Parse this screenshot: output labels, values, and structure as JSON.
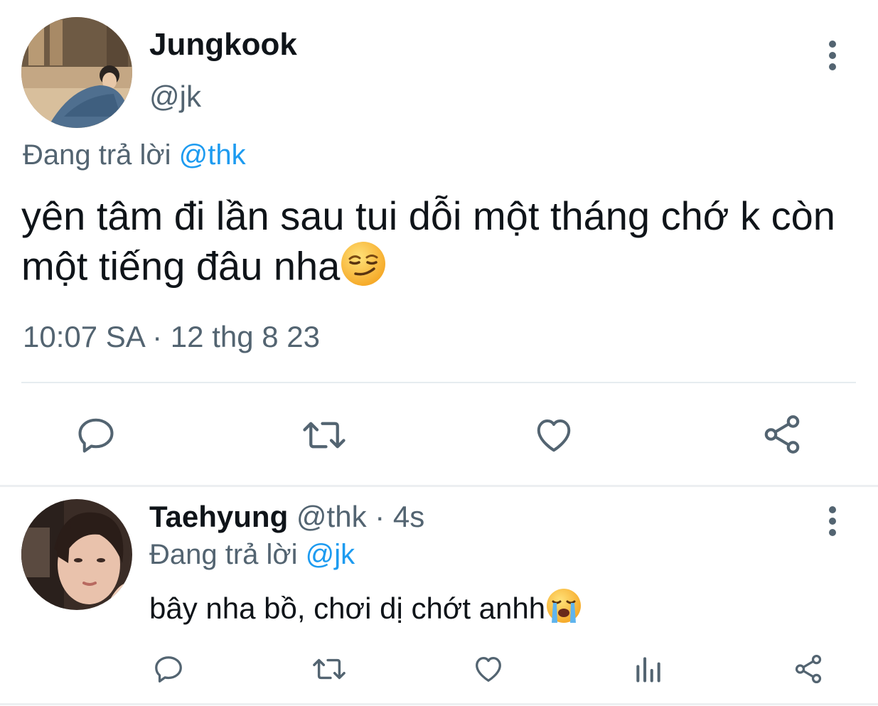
{
  "main_tweet": {
    "display_name": "Jungkook",
    "handle": "@jk",
    "replying_prefix": "Đang trả lời",
    "replying_to": "@thk",
    "text": "yên tâm đi lần sau tui dỗi một tháng chớ k còn một tiếng đâu nha",
    "emoji": "smirking-face-emoji",
    "timestamp": "10:07 SA · 12 thg 8 23",
    "actions": [
      "reply-icon",
      "retweet-icon",
      "like-icon",
      "share-icon"
    ]
  },
  "reply_tweet": {
    "display_name": "Taehyung",
    "handle": "@thk",
    "time_ago": "· 4s",
    "replying_prefix": "Đang trả lời",
    "replying_to": "@jk",
    "text": "bây nha bồ, chơi dị chớt anhh",
    "emoji": "loudly-crying-face-emoji",
    "actions": [
      "reply-icon",
      "retweet-icon",
      "like-icon",
      "stats-icon",
      "share-icon"
    ]
  },
  "colors": {
    "text": "#0f1419",
    "secondary": "#536471",
    "link": "#1d9bf0",
    "divider": "#e6ecf0"
  }
}
